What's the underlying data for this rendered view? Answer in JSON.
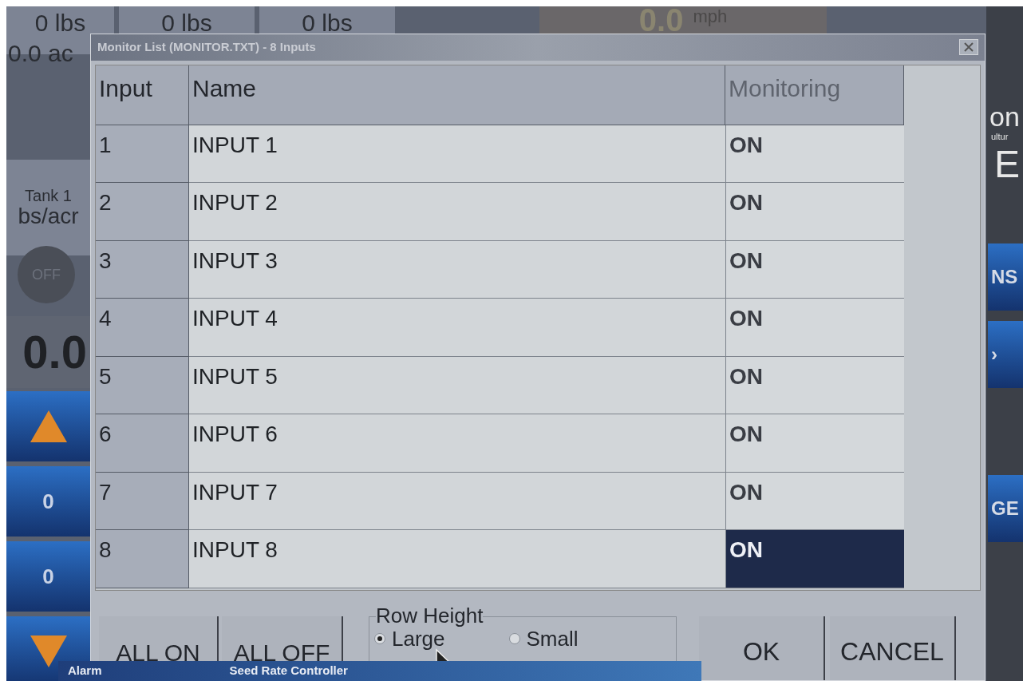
{
  "background_app": {
    "top_totals": [
      "0 lbs",
      "0 lbs",
      "0 lbs"
    ],
    "area": "0.0 ac",
    "speed": {
      "value": "0.0",
      "unit": "mph"
    },
    "tank_label": "Tank 1",
    "rate_unit": "bs/acr",
    "toggle": {
      "label": "OFF",
      "on": false
    },
    "rate_value": "0.0",
    "side_buttons": [
      {
        "kind": "up"
      },
      {
        "kind": "value",
        "label": "0"
      },
      {
        "kind": "value",
        "label": "0"
      },
      {
        "kind": "down"
      }
    ],
    "right_panel": {
      "logo_texts": [
        "on",
        "ultur"
      ],
      "letter": "E",
      "buttons": [
        "NS",
        "›",
        "GE"
      ]
    },
    "bottom_window": {
      "title_left": "Alarm",
      "title": "Seed Rate Controller"
    }
  },
  "dialog": {
    "title": "Monitor List (MONITOR.TXT) - 8 Inputs",
    "columns": [
      "Input",
      "Name",
      "Monitoring"
    ],
    "rows": [
      {
        "input": "1",
        "name": "INPUT 1",
        "monitoring": "ON",
        "selected": false
      },
      {
        "input": "2",
        "name": "INPUT 2",
        "monitoring": "ON",
        "selected": false
      },
      {
        "input": "3",
        "name": "INPUT 3",
        "monitoring": "ON",
        "selected": false
      },
      {
        "input": "4",
        "name": "INPUT 4",
        "monitoring": "ON",
        "selected": false
      },
      {
        "input": "5",
        "name": "INPUT 5",
        "monitoring": "ON",
        "selected": false
      },
      {
        "input": "6",
        "name": "INPUT 6",
        "monitoring": "ON",
        "selected": false
      },
      {
        "input": "7",
        "name": "INPUT 7",
        "monitoring": "ON",
        "selected": false
      },
      {
        "input": "8",
        "name": "INPUT 8",
        "monitoring": "ON",
        "selected": true
      }
    ],
    "left_buttons": [
      "ALL ON",
      "ALL OFF"
    ],
    "row_height": {
      "label": "Row Height",
      "options": [
        {
          "label": "Large",
          "selected": true
        },
        {
          "label": "Small",
          "selected": false
        }
      ]
    },
    "right_buttons": [
      "OK",
      "CANCEL"
    ]
  }
}
